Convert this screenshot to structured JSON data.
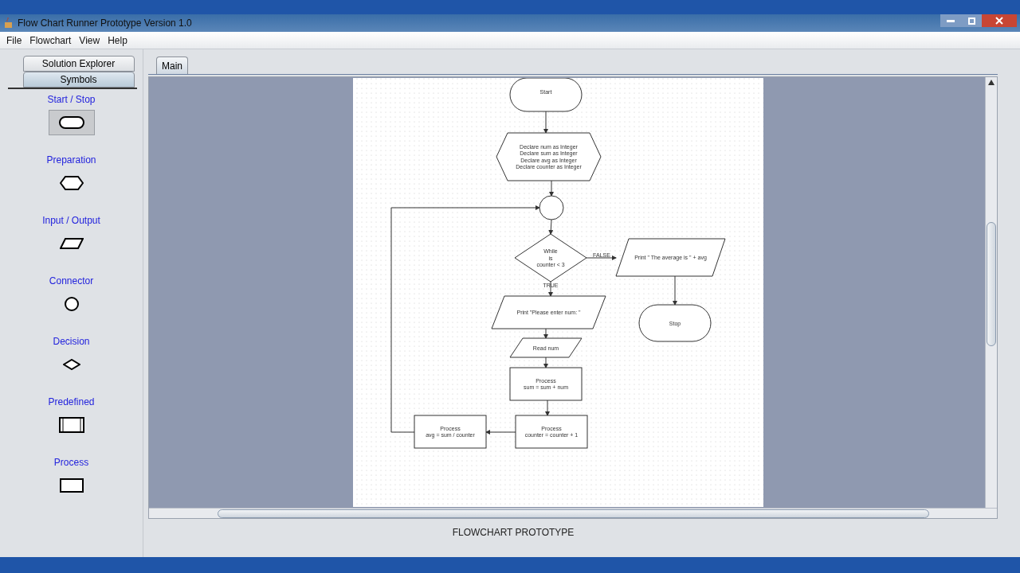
{
  "window": {
    "title": "Flow Chart Runner Prototype Version 1.0"
  },
  "menu": [
    "File",
    "Flowchart",
    "View",
    "Help"
  ],
  "side_tabs": [
    {
      "label": "Solution Explorer",
      "selected": false
    },
    {
      "label": "Symbols",
      "selected": true
    }
  ],
  "symbols": [
    {
      "label": "Start / Stop",
      "kind": "terminal",
      "selected": true
    },
    {
      "label": "Preparation",
      "kind": "preparation",
      "selected": false
    },
    {
      "label": "Input / Output",
      "kind": "io",
      "selected": false
    },
    {
      "label": "Connector",
      "kind": "connector",
      "selected": false
    },
    {
      "label": "Decision",
      "kind": "decision",
      "selected": false
    },
    {
      "label": "Predefined",
      "kind": "predefined",
      "selected": false
    },
    {
      "label": "Process",
      "kind": "process",
      "selected": false
    }
  ],
  "main_tabs": [
    {
      "label": "Main",
      "selected": true
    }
  ],
  "flowchart": {
    "nodes": [
      {
        "kind": "terminal",
        "lines": [
          "Start"
        ]
      },
      {
        "kind": "preparation",
        "lines": [
          "Declare num as Integer",
          "Declare sum as Integer",
          "Declare avg as Integer",
          "Declare counter as Integer"
        ]
      },
      {
        "kind": "connector"
      },
      {
        "kind": "decision",
        "lines": [
          "While",
          "is",
          "counter < 3"
        ]
      },
      {
        "kind": "io",
        "lines": [
          "Print \" The average is \" + avg"
        ]
      },
      {
        "kind": "terminal",
        "lines": [
          "Stop"
        ]
      },
      {
        "kind": "io",
        "lines": [
          "Print \"Please enter num: \""
        ]
      },
      {
        "kind": "io",
        "lines": [
          "Read num"
        ]
      },
      {
        "kind": "process",
        "lines": [
          "Process",
          "sum = sum + num"
        ]
      },
      {
        "kind": "process",
        "lines": [
          "Process",
          "avg = sum / counter"
        ]
      },
      {
        "kind": "process",
        "lines": [
          "Process",
          "counter = counter + 1"
        ]
      }
    ],
    "edge_labels": [
      "FALSE",
      "TRUE"
    ]
  },
  "footer": "FLOWCHART PROTOTYPE"
}
